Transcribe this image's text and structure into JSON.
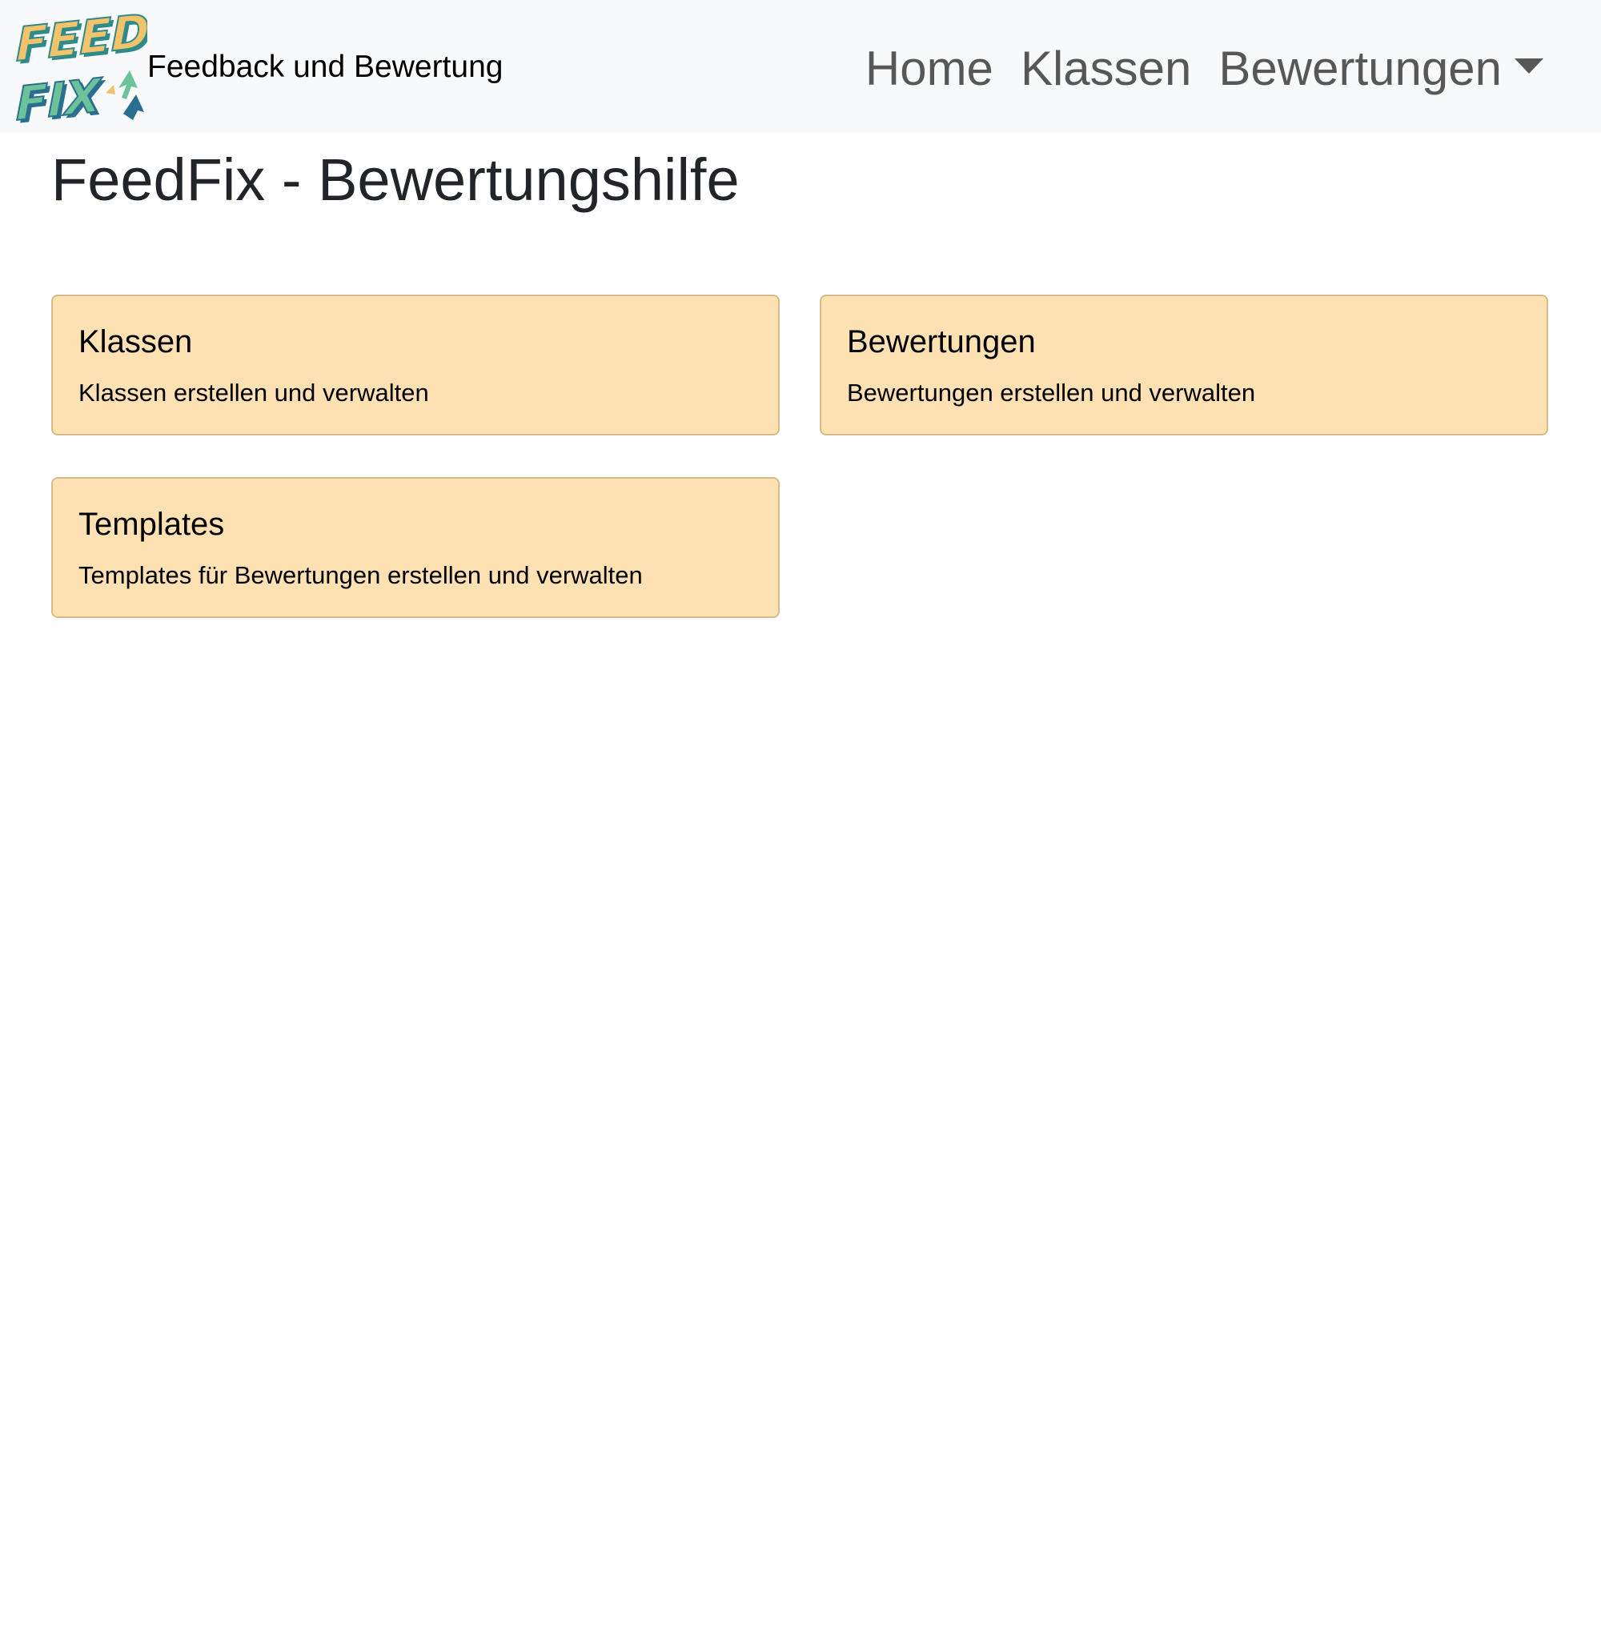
{
  "navbar": {
    "brand_text": "Feedback und Bewertung",
    "logo": {
      "line1": "FEED",
      "line2": "FIX",
      "colors": {
        "yellow": "#f2c36b",
        "teal": "#2f8a8a",
        "green": "#6cc39a",
        "blue": "#2a6f8f"
      }
    },
    "links": [
      {
        "label": "Home"
      },
      {
        "label": "Klassen"
      },
      {
        "label": "Bewertungen"
      }
    ]
  },
  "main": {
    "title": "FeedFix - Bewertungshilfe",
    "cards": [
      {
        "title": "Klassen",
        "text": "Klassen erstellen und verwalten"
      },
      {
        "title": "Bewertungen",
        "text": "Bewertungen erstellen und verwalten"
      },
      {
        "title": "Templates",
        "text": "Templates für Bewertungen erstellen und verwalten"
      }
    ]
  },
  "colors": {
    "navbar_bg": "#f8f9fa",
    "card_bg": "#fde1b3",
    "card_border": "#d8bb8a",
    "nav_link": "#595959"
  }
}
